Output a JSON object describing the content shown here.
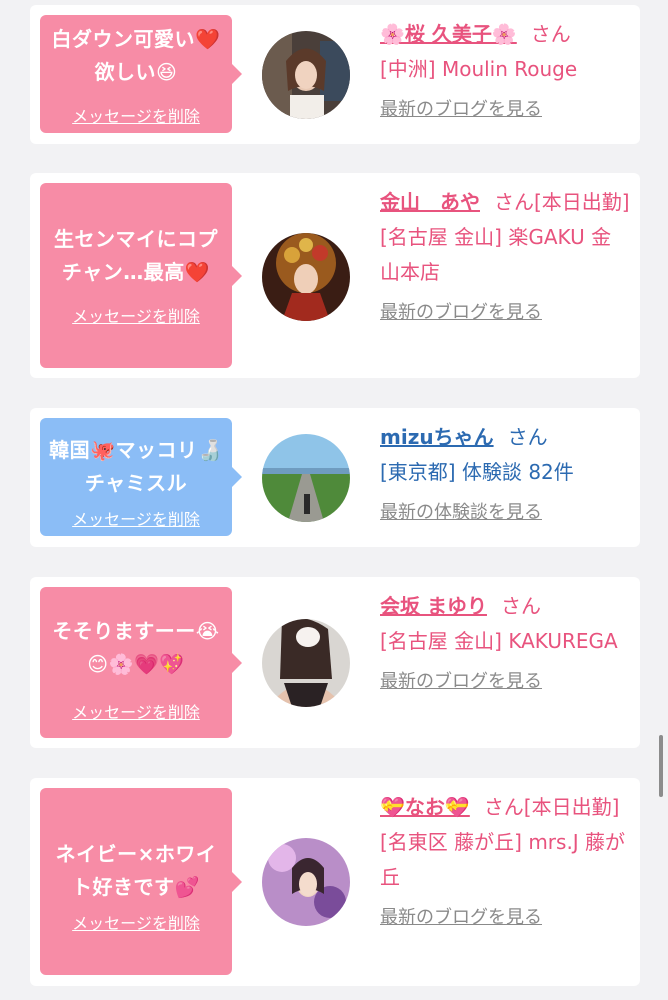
{
  "cards": [
    {
      "message": "白ダウン可愛い❤️欲しい😆",
      "delete_label": "メッセージを削除",
      "name": "🌸桜 久美子🌸",
      "honorific": "さん",
      "shop": "[中洲] Moulin Rouge",
      "link": "最新のブログを見る",
      "bubble_color": "#f78ca6"
    },
    {
      "message": "生センマイにコプチャン…最高❤️",
      "delete_label": "メッセージを削除",
      "name": "金山　あや",
      "honorific": "さん[本日出勤]",
      "shop": "[名古屋 金山] 楽GAKU 金山本店",
      "link": "最新のブログを見る",
      "bubble_color": "#f78ca6"
    },
    {
      "message": "韓国🐙マッコリ🍶チャミスル",
      "delete_label": "メッセージを削除",
      "name": "mizuちゃん",
      "honorific": "さん",
      "shop": "[東京都] 体験談 82件",
      "link": "最新の体験談を見る",
      "bubble_color": "#8bbdf6"
    },
    {
      "message": "そそりますーー😭😊🌸💗💖",
      "delete_label": "メッセージを削除",
      "name": "会坂 まゆり",
      "honorific": "さん",
      "shop": "[名古屋 金山] KAKUREGA",
      "link": "最新のブログを見る",
      "bubble_color": "#f78ca6"
    },
    {
      "message": "ネイビー×ホワイト好きです💕",
      "delete_label": "メッセージを削除",
      "name": "💝なお💝",
      "honorific": "さん[本日出勤]",
      "shop": "[名東区 藤が丘] mrs.J 藤が丘",
      "link": "最新のブログを見る",
      "bubble_color": "#f78ca6"
    }
  ]
}
